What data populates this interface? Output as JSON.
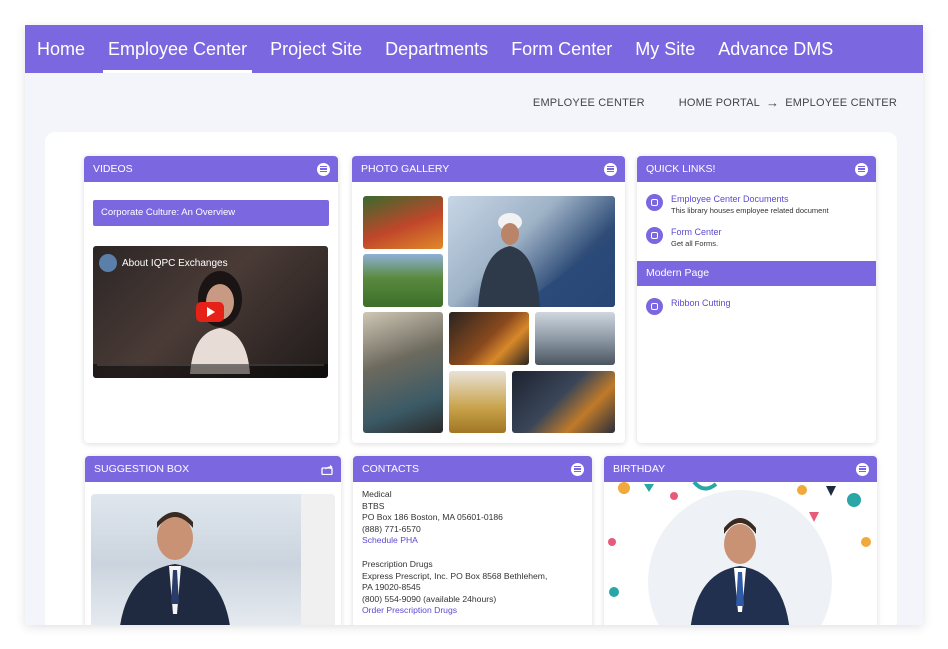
{
  "nav": {
    "items": [
      "Home",
      "Employee Center",
      "Project Site",
      "Departments",
      "Form Center",
      "My Site",
      "Advance DMS"
    ],
    "active_index": 1
  },
  "breadcrumb": {
    "page": "EMPLOYEE CENTER",
    "path": [
      "HOME PORTAL",
      "EMPLOYEE CENTER"
    ]
  },
  "videos": {
    "title": "VIDEOS",
    "label": "Corporate Culture: An Overview",
    "video_title": "About IQPC Exchanges"
  },
  "gallery": {
    "title": "PHOTO GALLERY"
  },
  "quick_links": {
    "title": "QUICK LINKS!",
    "items": [
      {
        "title": "Employee Center Documents",
        "desc": "This library houses employee related document"
      },
      {
        "title": "Form Center",
        "desc": "Get all Forms."
      }
    ],
    "section_title": "Modern Page",
    "section_items": [
      {
        "title": "Ribbon Cutting"
      }
    ]
  },
  "suggestion": {
    "title": "SUGGESTION BOX"
  },
  "contacts": {
    "title": "CONTACTS",
    "groups": [
      {
        "lines": [
          "Medical",
          "BTBS",
          "PO Box 186 Boston, MA 05601-0186",
          "(888) 771-6570"
        ],
        "link": "Schedule PHA"
      },
      {
        "lines": [
          "Prescription Drugs",
          "Express Prescript, Inc. PO Box 8568 Bethlehem,",
          "PA 19020-8545",
          "(800) 554-9090 (available 24hours)"
        ],
        "link": "Order Prescription Drugs"
      }
    ]
  },
  "birthday": {
    "title": "BIRTHDAY"
  },
  "colors": {
    "accent": "#7b68e0",
    "link": "#5b4ad0",
    "page_bg": "#f3f5fa"
  }
}
